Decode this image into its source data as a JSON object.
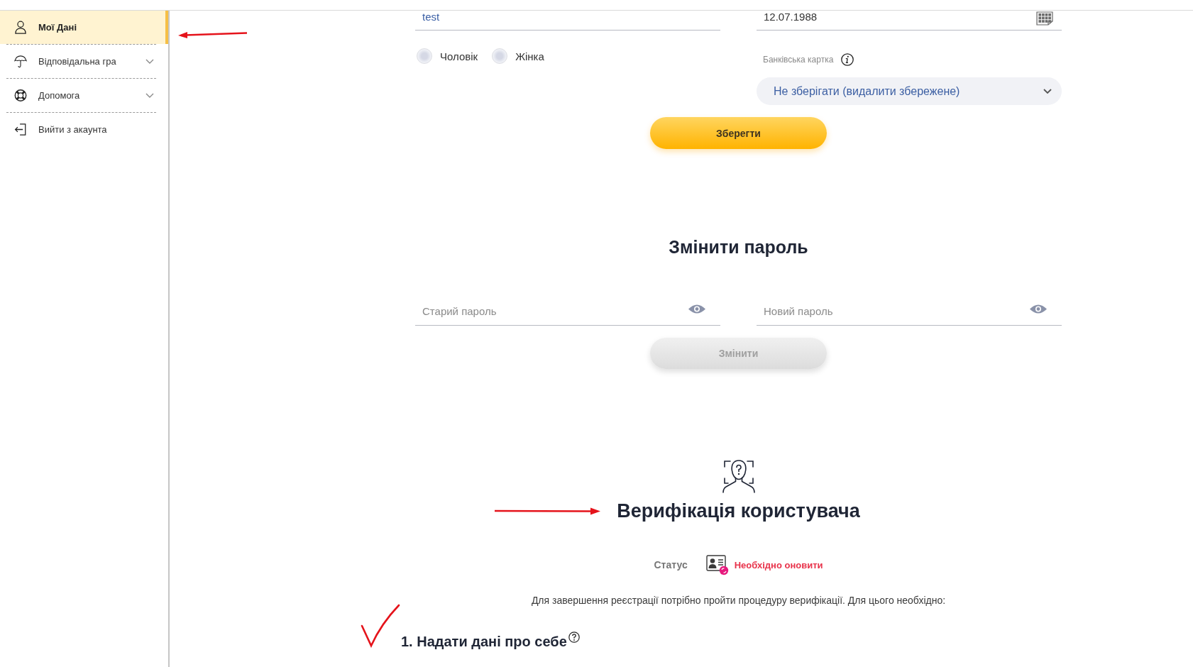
{
  "sidebar": {
    "items": [
      {
        "label": "Мої Дані",
        "selected": true,
        "expandable": false
      },
      {
        "label": "Відповідальна гра",
        "selected": false,
        "expandable": true
      },
      {
        "label": "Допомога",
        "selected": false,
        "expandable": true
      },
      {
        "label": "Вийти з акаунта",
        "selected": false,
        "expandable": false
      }
    ]
  },
  "profile_form": {
    "fields": [
      {
        "kind": "text",
        "value": "test"
      },
      {
        "kind": "date",
        "value": "12.07.1988"
      }
    ],
    "gender_options": [
      {
        "label": "Чоловік",
        "selected": false
      },
      {
        "label": "Жінка",
        "selected": false
      }
    ],
    "bank_card": {
      "label": "Банківська картка",
      "value": "Не зберігати (видалити збережене)"
    },
    "save_button": {
      "label": "Зберегти",
      "disabled": false
    }
  },
  "change_password": {
    "title": "Змінити пароль",
    "fields": [
      {
        "placeholder": "Старий пароль"
      },
      {
        "placeholder": "Новий пароль"
      }
    ],
    "button": {
      "label": "Змінити",
      "disabled": true
    }
  },
  "verification": {
    "title": "Верифікація користувача",
    "status_label": "Статус",
    "status": "Необхідно оновити",
    "description": "Для завершення реєстрації потрібно пройти процедуру верифікації. Для цього необхідно:",
    "steps": [
      {
        "title": "1. Надати дані про себе"
      }
    ]
  }
}
